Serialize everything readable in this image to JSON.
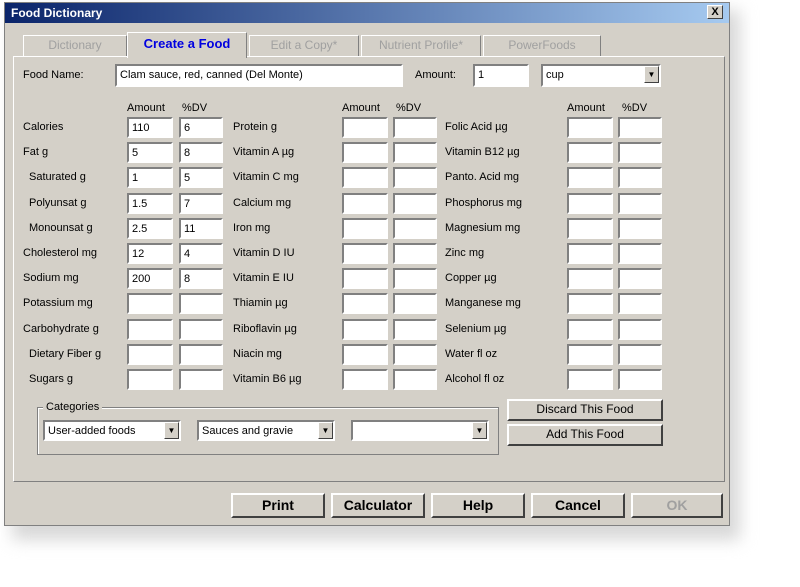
{
  "window": {
    "title": "Food Dictionary",
    "close_label": "X"
  },
  "tabs": [
    {
      "label": "Dictionary"
    },
    {
      "label": "Create a Food"
    },
    {
      "label": "Edit a Copy*"
    },
    {
      "label": "Nutrient Profile*"
    },
    {
      "label": "PowerFoods"
    }
  ],
  "food": {
    "name_label": "Food Name:",
    "name_value": "Clam sauce, red, canned (Del Monte)",
    "amount_label": "Amount:",
    "amount_value": "1",
    "unit_value": "cup"
  },
  "headers": {
    "amount": "Amount",
    "dv": "%DV"
  },
  "col1": [
    {
      "label": "Calories",
      "amount": "110",
      "dv": "6"
    },
    {
      "label": "Fat  g",
      "amount": "5",
      "dv": "8"
    },
    {
      "label": "Saturated  g",
      "amount": "1",
      "dv": "5"
    },
    {
      "label": "Polyunsat  g",
      "amount": "1.5",
      "dv": "7"
    },
    {
      "label": "Monounsat  g",
      "amount": "2.5",
      "dv": "11"
    },
    {
      "label": "Cholesterol  mg",
      "amount": "12",
      "dv": "4"
    },
    {
      "label": "Sodium  mg",
      "amount": "200",
      "dv": "8"
    },
    {
      "label": "Potassium  mg",
      "amount": "",
      "dv": ""
    },
    {
      "label": "Carbohydrate g",
      "amount": "",
      "dv": ""
    },
    {
      "label": "Dietary Fiber g",
      "amount": "",
      "dv": ""
    },
    {
      "label": "Sugars  g",
      "amount": "",
      "dv": ""
    }
  ],
  "col2": [
    {
      "label": "Protein  g",
      "amount": "",
      "dv": ""
    },
    {
      "label": "Vitamin A µg",
      "amount": "",
      "dv": ""
    },
    {
      "label": "Vitamin C mg",
      "amount": "",
      "dv": ""
    },
    {
      "label": "Calcium mg",
      "amount": "",
      "dv": ""
    },
    {
      "label": "Iron mg",
      "amount": "",
      "dv": ""
    },
    {
      "label": "Vitamin D IU",
      "amount": "",
      "dv": ""
    },
    {
      "label": "Vitamin E IU",
      "amount": "",
      "dv": ""
    },
    {
      "label": "Thiamin µg",
      "amount": "",
      "dv": ""
    },
    {
      "label": "Riboflavin µg",
      "amount": "",
      "dv": ""
    },
    {
      "label": "Niacin mg",
      "amount": "",
      "dv": ""
    },
    {
      "label": "Vitamin B6 µg",
      "amount": "",
      "dv": ""
    }
  ],
  "col3": [
    {
      "label": "Folic Acid µg",
      "amount": "",
      "dv": ""
    },
    {
      "label": "Vitamin B12 µg",
      "amount": "",
      "dv": ""
    },
    {
      "label": "Panto. Acid mg",
      "amount": "",
      "dv": ""
    },
    {
      "label": "Phosphorus mg",
      "amount": "",
      "dv": ""
    },
    {
      "label": "Magnesium mg",
      "amount": "",
      "dv": ""
    },
    {
      "label": "Zinc mg",
      "amount": "",
      "dv": ""
    },
    {
      "label": "Copper µg",
      "amount": "",
      "dv": ""
    },
    {
      "label": "Manganese mg",
      "amount": "",
      "dv": ""
    },
    {
      "label": "Selenium  µg",
      "amount": "",
      "dv": ""
    },
    {
      "label": "Water fl oz",
      "amount": "",
      "dv": ""
    },
    {
      "label": "Alcohol  fl oz",
      "amount": "",
      "dv": ""
    }
  ],
  "categories": {
    "label": "Categories",
    "selects": [
      "User-added foods",
      "Sauces and gravie",
      ""
    ]
  },
  "actions": {
    "discard": "Discard This Food",
    "add": "Add This Food"
  },
  "footer": {
    "print": "Print",
    "calculator": "Calculator",
    "help": "Help",
    "cancel": "Cancel",
    "ok": "OK"
  },
  "icons": {
    "dropdown": "chevron-down-icon",
    "close": "close-icon"
  },
  "colors": {
    "title_start": "#0a246a",
    "title_end": "#a6caf0",
    "active_tab_text": "#0000e0",
    "face": "#d4d0c8"
  }
}
